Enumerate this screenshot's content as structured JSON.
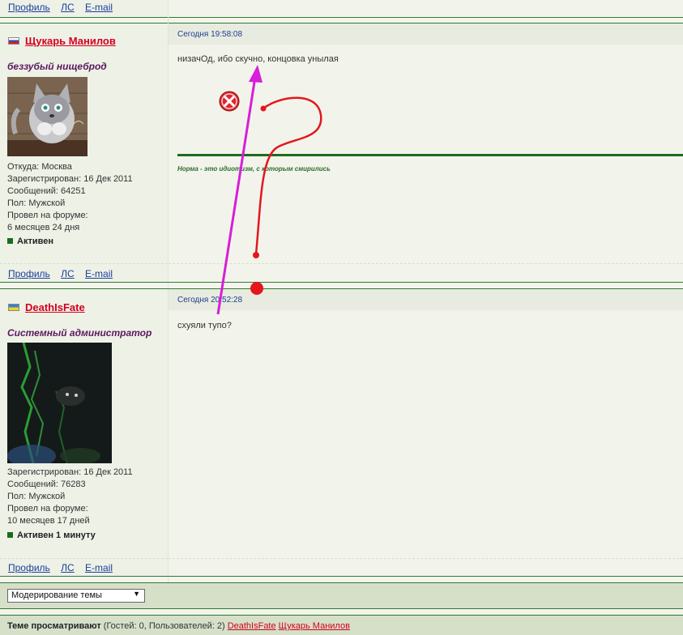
{
  "profile_links": {
    "profile": "Профиль",
    "pm": "ЛС",
    "email": "E-mail"
  },
  "posts": [
    {
      "author": "Щукарь Манилов",
      "country": "ru",
      "user_title": "беззубый нищеброд",
      "info": [
        "Откуда: Москва",
        "Зарегистрирован: 16 Дек 2011",
        "Сообщений: 64251",
        "Пол: Мужской",
        "Провел на форуме:",
        "6 месяцев 24 дня"
      ],
      "status": "Активен",
      "date": "Сегодня 19:58:08",
      "message": "низачОд, ибо скучно, концовка унылая",
      "signature": "Норма - это идиотизм, с которым смирились"
    },
    {
      "author": "DeathIsFate",
      "country": "ua",
      "user_title": "Системный администратор",
      "info": [
        "Зарегистрирован: 16 Дек 2011",
        "Сообщений: 76283",
        "Пол: Мужской",
        "Провел на форуме:",
        "10 месяцев 17 дней"
      ],
      "status": "Активен 1 минуту",
      "date": "Сегодня 20:52:28",
      "message": "схуяли тупо?"
    }
  ],
  "moderation": {
    "selected": "Модерирование темы"
  },
  "viewers": {
    "label": "Теме просматривают",
    "counts": "(Гостей: 0, Пользователей: 2)",
    "users": [
      "DeathIsFate",
      "Щукарь Манилов"
    ]
  },
  "colors": {
    "username": "#d3001f",
    "link": "#1a3f9e",
    "separator": "#2f7a2f",
    "annotation_arrow": "#d81ed8",
    "annotation_question": "#e5161e"
  },
  "icons": [
    "close-icon",
    "flag-ru-icon",
    "flag-ua-icon",
    "dropdown-arrow-icon"
  ]
}
